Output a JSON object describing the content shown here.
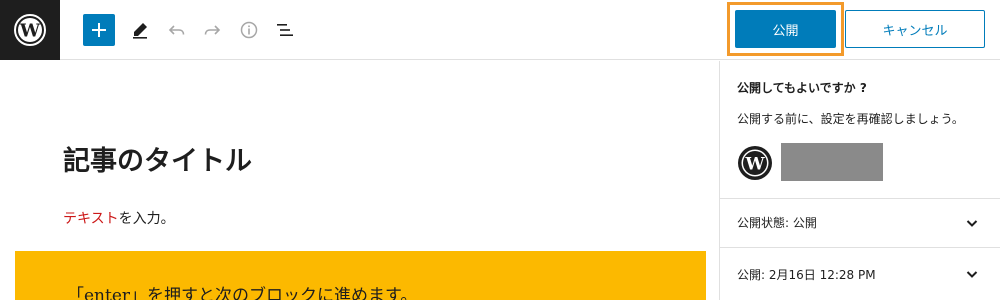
{
  "toolbar": {
    "logo_icon": "wordpress-logo-icon",
    "inserter_icon": "plus-icon",
    "tools_icon": "pencil-icon",
    "undo_icon": "undo-icon",
    "redo_icon": "redo-icon",
    "info_icon": "info-icon",
    "outline_icon": "list-view-icon",
    "publish_label": "公開",
    "cancel_label": "キャンセル"
  },
  "colors": {
    "accent": "#007cba",
    "highlight": "#f39a2b",
    "block_bg": "#fcb900",
    "red_text": "#cc1818"
  },
  "editor": {
    "title": "記事のタイトル",
    "paragraph_red": "テキスト",
    "paragraph_rest": "を入力。",
    "yellow_block_text": "「enter」を押すと次のブロックに進めます。"
  },
  "sidebar": {
    "heading": "公開してもよいですか ?",
    "description": "公開する前に、設定を再確認しましょう。",
    "site_icon": "wordpress-logo-icon",
    "rows": [
      {
        "label": "公開状態: 公開"
      },
      {
        "label": "公開: 2月16日 12:28 PM"
      }
    ]
  }
}
